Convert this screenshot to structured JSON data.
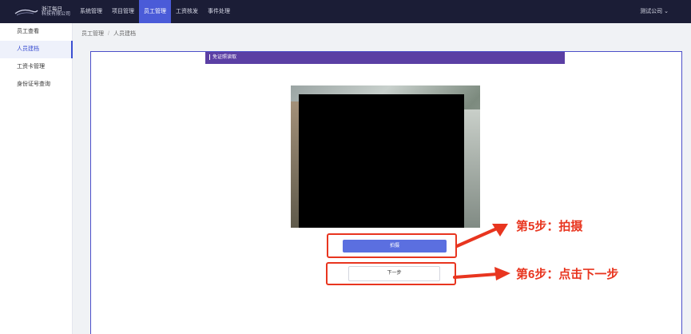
{
  "header": {
    "logo": {
      "line1": "浙江每日",
      "line2": "科技有限公司"
    },
    "nav": [
      {
        "label": "系统管理",
        "active": false
      },
      {
        "label": "项目管理",
        "active": false
      },
      {
        "label": "员工管理",
        "active": true
      },
      {
        "label": "工资核发",
        "active": false
      },
      {
        "label": "事件处理",
        "active": false
      }
    ],
    "company": "测试公司 ⌄"
  },
  "sidebar": {
    "items": [
      {
        "label": "员工查看",
        "active": false
      },
      {
        "label": "人员建档",
        "active": true
      },
      {
        "label": "工资卡管理",
        "active": false
      },
      {
        "label": "身份证号查询",
        "active": false
      }
    ]
  },
  "breadcrumb": {
    "items": [
      "员工管理",
      "人员建档"
    ],
    "separator": "/"
  },
  "card": {
    "title": "免证照读取"
  },
  "buttons": {
    "capture": "拍摄",
    "next": "下一步"
  },
  "annotations": {
    "step5": "第5步：拍摄",
    "step6": "第6步：点击下一步"
  },
  "colors": {
    "topbar": "#1b1d36",
    "nav_active": "#4a5bd8",
    "card_header": "#5b3fa4",
    "primary_button": "#5b6fe0",
    "annotation": "#e8351f"
  }
}
